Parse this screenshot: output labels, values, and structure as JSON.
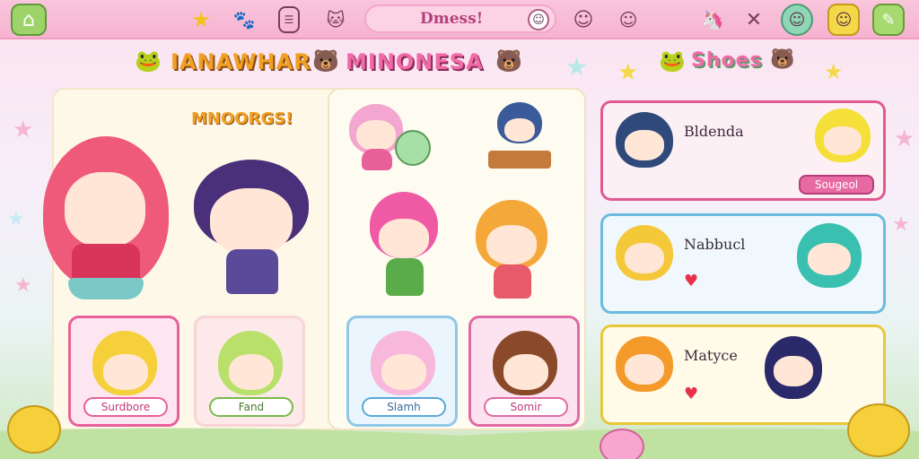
{
  "topbar": {
    "search_text": "Dmess!",
    "icons": [
      "home-icon",
      "star-icon",
      "dog-icon",
      "card-icon",
      "cat-icon",
      "smile-icon",
      "blob-icon",
      "unicorn-icon",
      "close-icon",
      "slime-icon",
      "face-button-icon",
      "pencil-icon"
    ]
  },
  "titles": {
    "left": "IANAWHAR",
    "middle": "MINONESA",
    "right": "Shoes"
  },
  "minor_title": "MNOORGS!",
  "bottom_cards": [
    {
      "label": "Surdbore",
      "color": "#e8609a",
      "bg": "#fde6ef"
    },
    {
      "label": "Fand",
      "color": "#79b94a",
      "bg": "#fde9ea"
    },
    {
      "label": "Slamh",
      "color": "#5aa8d8",
      "bg": "#eaf5fd"
    },
    {
      "label": "Somir",
      "color": "#e06aa5",
      "bg": "#fde3ef"
    }
  ],
  "right_cards": [
    {
      "name": "Bldenda",
      "pill": "Sougeol",
      "color": "#e05a8f"
    },
    {
      "name": "Nabbucl",
      "pill": "",
      "color": "#6abbe0"
    },
    {
      "name": "Matyce",
      "pill": "",
      "color": "#e8c83a"
    }
  ],
  "colors": {
    "accent_pink": "#f06aa8",
    "accent_gold": "#f0a022",
    "topbar": "#f7b8d3"
  }
}
